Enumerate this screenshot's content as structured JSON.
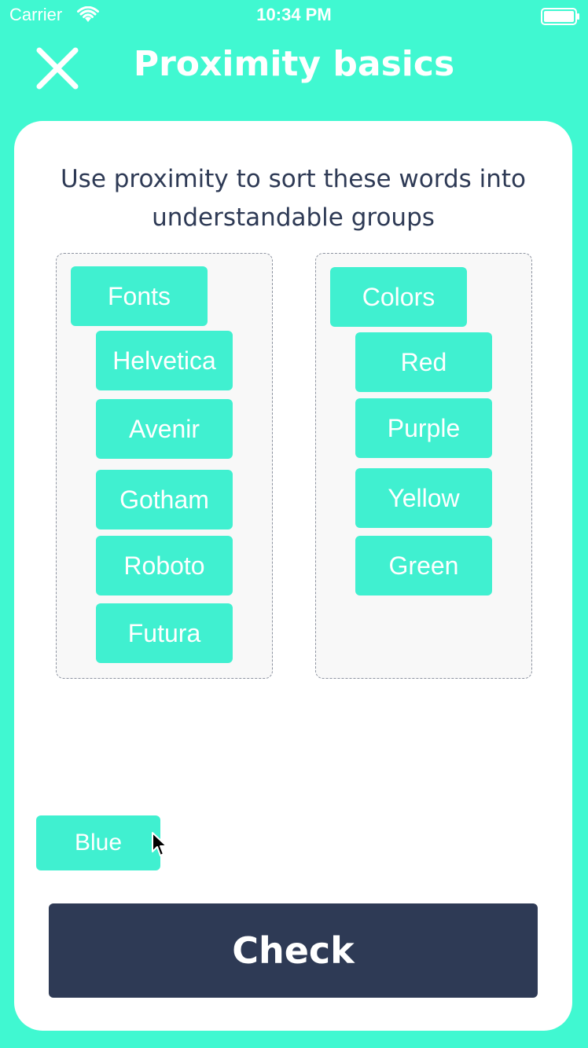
{
  "status_bar": {
    "carrier": "Carrier",
    "time": "10:34 PM"
  },
  "header": {
    "title": "Proximity basics",
    "close_icon": "close-icon"
  },
  "card": {
    "instructions": "Use proximity to sort these words into understandable groups"
  },
  "groups": {
    "fonts": {
      "header": "Fonts",
      "items": [
        "Helvetica",
        "Avenir",
        "Gotham",
        "Roboto",
        "Futura"
      ]
    },
    "colors": {
      "header": "Colors",
      "items": [
        "Red",
        "Purple",
        "Yellow",
        "Green"
      ]
    }
  },
  "loose_chip": {
    "label": "Blue"
  },
  "check_button": {
    "label": "Check"
  },
  "colors": {
    "background": "#40F8D1",
    "chip": "#40F0D0",
    "dark": "#2E3A55",
    "card": "#FFFFFF"
  }
}
